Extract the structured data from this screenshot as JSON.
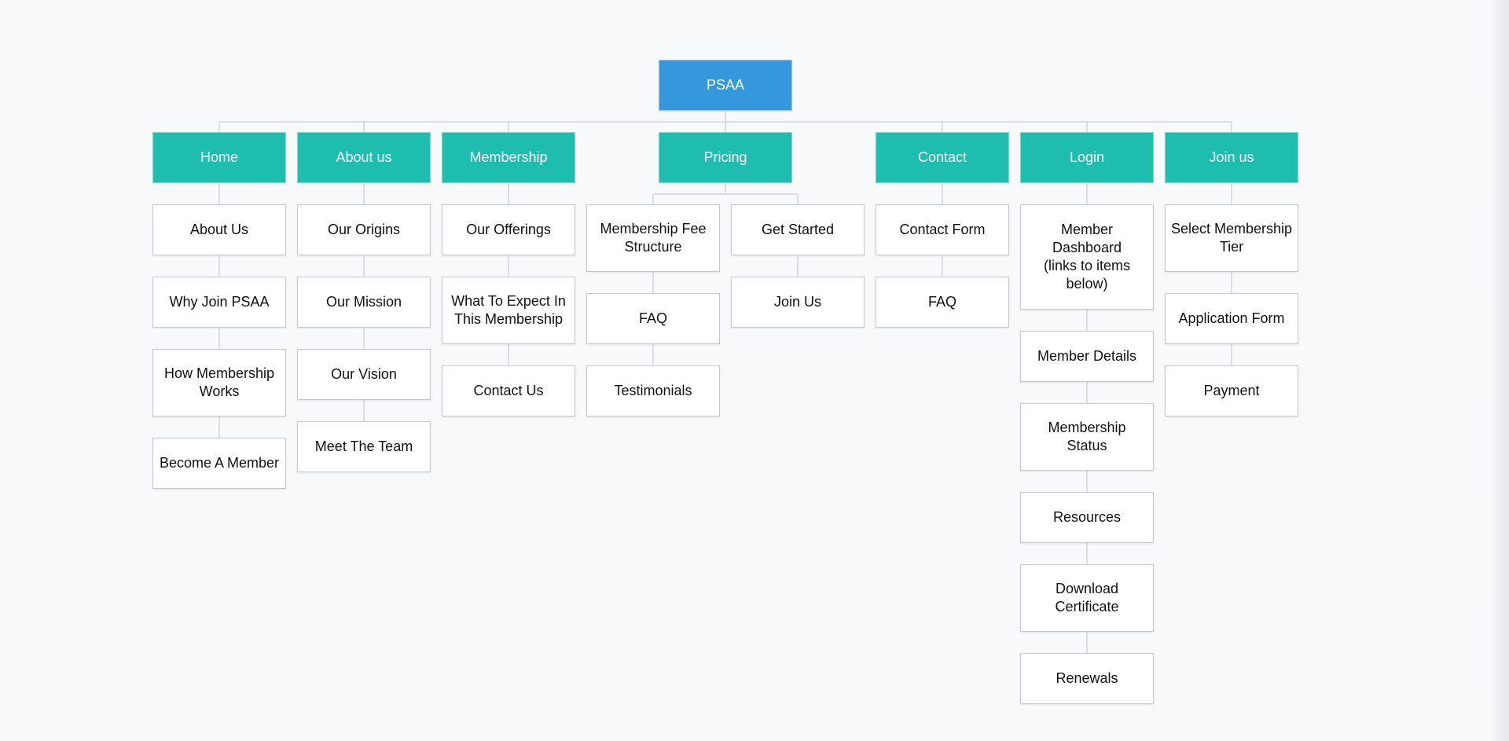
{
  "sitemap": {
    "root": "PSAA",
    "sections": [
      {
        "title": "Home",
        "pages": [
          "About Us",
          "Why Join PSAA",
          "How Membership Works",
          "Become A Member"
        ]
      },
      {
        "title": "About us",
        "pages": [
          "Our Origins",
          "Our Mission",
          "Our Vision",
          "Meet The Team"
        ]
      },
      {
        "title": "Membership",
        "pages": [
          "Our Offerings",
          "What To Expect In This Membership",
          "Contact Us"
        ]
      },
      {
        "title": "Pricing",
        "branches": [
          [
            "Membership Fee Structure",
            "FAQ",
            "Testimonials"
          ],
          [
            "Get Started",
            "Join Us"
          ]
        ]
      },
      {
        "title": "Contact",
        "pages": [
          "Contact Form",
          "FAQ"
        ]
      },
      {
        "title": "Login",
        "pages": [
          "Member Dashboard (links to items below)",
          "Member Details",
          "Membership Status",
          "Resources",
          "Download Certificate",
          "Renewals"
        ]
      },
      {
        "title": "Join us",
        "pages": [
          "Select Membership Tier",
          "Application Form",
          "Payment"
        ]
      }
    ]
  },
  "colors": {
    "root": "#3698dc",
    "section": "#1fbcb0",
    "page": "#ffffff",
    "connector": "#c9cdd3",
    "background": "#f8f9fb"
  }
}
